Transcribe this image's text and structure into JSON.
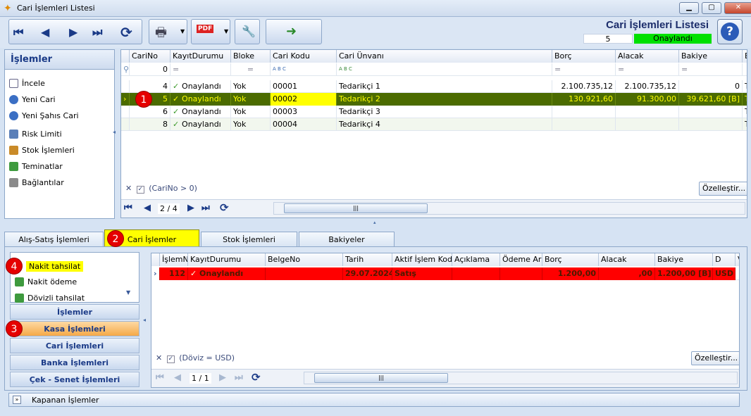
{
  "window": {
    "title": "Cari İşlemleri Listesi",
    "min": "▁",
    "max": "▢",
    "close": "✕"
  },
  "header": {
    "title": "Cari İşlemleri Listesi",
    "record_no": "5",
    "status": "Onaylandı"
  },
  "left_panel": {
    "title": "İşlemler",
    "items": [
      {
        "label": "İncele",
        "icon": "document-icon"
      },
      {
        "label": "Yeni Cari",
        "icon": "add-icon"
      },
      {
        "label": "Yeni Şahıs Cari",
        "icon": "add-icon"
      },
      {
        "label": "Risk Limiti",
        "icon": "chart-icon"
      },
      {
        "label": "Stok İşlemleri",
        "icon": "box-icon"
      },
      {
        "label": "Teminatlar",
        "icon": "money-icon"
      },
      {
        "label": "Bağlantılar",
        "icon": "link-icon"
      }
    ]
  },
  "grid": {
    "columns": [
      "CariNo",
      "KayıtDurumu",
      "Bloke",
      "Cari Kodu",
      "Cari Ünvanı",
      "Borç",
      "Alacak",
      "Bakiye",
      "B"
    ],
    "filter_row": {
      "cari_no": "0",
      "operator": "=",
      "text_op": "A B C"
    },
    "rows": [
      {
        "cari_no": "4",
        "durum": "Onaylandı",
        "bloke": "Yok",
        "kod": "00001",
        "unvan": "Tedarikçi 1",
        "borc": "2.100.735,12",
        "alacak": "2.100.735,12",
        "bakiye": "0",
        "b": "T"
      },
      {
        "cari_no": "5",
        "durum": "Onaylandı",
        "bloke": "Yok",
        "kod": "00002",
        "unvan": "Tedarikçi 2",
        "borc": "130.921,60",
        "alacak": "91.300,00",
        "bakiye": "39.621,60 [B]",
        "b": "T"
      },
      {
        "cari_no": "6",
        "durum": "Onaylandı",
        "bloke": "Yok",
        "kod": "00003",
        "unvan": "Tedarikçi 3",
        "borc": "",
        "alacak": "",
        "bakiye": "",
        "b": "T"
      },
      {
        "cari_no": "8",
        "durum": "Onaylandı",
        "bloke": "Yok",
        "kod": "00004",
        "unvan": "Tedarikçi 4",
        "borc": "",
        "alacak": "",
        "bakiye": "",
        "b": "T"
      }
    ],
    "filter_text": "(CariNo > 0)",
    "customize": "Özelleştir...",
    "pager": "2 / 4"
  },
  "tabs": [
    "Alış-Satış İşlemleri",
    "Cari İşlemler",
    "Stok İşlemleri",
    "Bakiyeler"
  ],
  "menu_items": [
    "Nakit tahsilat",
    "Nakit ödeme",
    "Dövizli tahsilat"
  ],
  "nav_buttons": [
    "İşlemler",
    "Kasa İşlemleri",
    "Cari İşlemleri",
    "Banka İşlemleri",
    "Çek - Senet İşlemleri"
  ],
  "grid2": {
    "columns": [
      "İşlemNo",
      "KayıtDurumu",
      "BelgeNo",
      "Tarih",
      "Aktif İşlem Kodu",
      "Açıklama",
      "Ödeme Aracı",
      "Borç",
      "Alacak",
      "Bakiye",
      "D",
      "V"
    ],
    "row": {
      "no": "112",
      "durum": "Onaylandı",
      "belge": "",
      "tarih": "29.07.2024",
      "kod": "Satış",
      "aciklama": "",
      "odeme": "",
      "borc": "1.200,00",
      "alacak": ",00",
      "bakiye": "1.200,00 [B]",
      "d": "USD"
    },
    "filter_text": "(Döviz = USD)",
    "customize": "Özelleştir...",
    "pager": "1 / 1"
  },
  "footer": "Kapanan İşlemler",
  "badges": [
    "1",
    "2",
    "3",
    "4"
  ]
}
